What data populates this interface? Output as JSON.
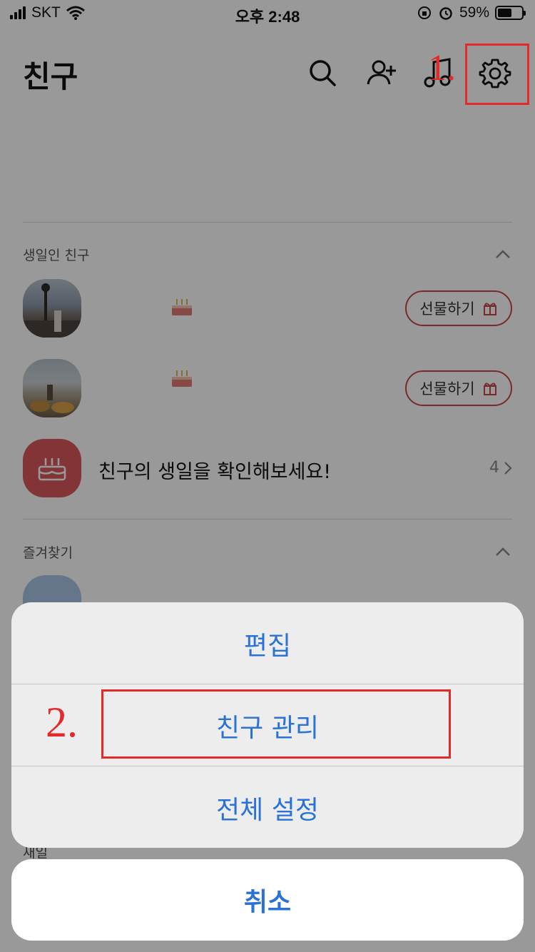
{
  "status_bar": {
    "carrier": "SKT",
    "time": "오후 2:48",
    "battery_percent": "59%",
    "battery_level": 0.59
  },
  "header": {
    "title": "친구",
    "icons": [
      "search-icon",
      "add-friend-icon",
      "music-icon",
      "settings-icon"
    ]
  },
  "annotations": {
    "step1": "1.",
    "step2": "2."
  },
  "sections": {
    "birthday": {
      "title": "생일인 친구",
      "gift_label": "선물하기",
      "promo_text": "친구의 생일을 확인해보세요!",
      "promo_count": "4"
    },
    "favorites": {
      "title": "즐겨찾기"
    },
    "hidden_section_peek": "새일"
  },
  "action_sheet": {
    "items": [
      "편집",
      "친구 관리",
      "전체 설정"
    ],
    "cancel": "취소"
  },
  "colors": {
    "accent_blue": "#2b72d6",
    "birthday_red": "#d9585c",
    "annotation_red": "#e32a2a"
  }
}
